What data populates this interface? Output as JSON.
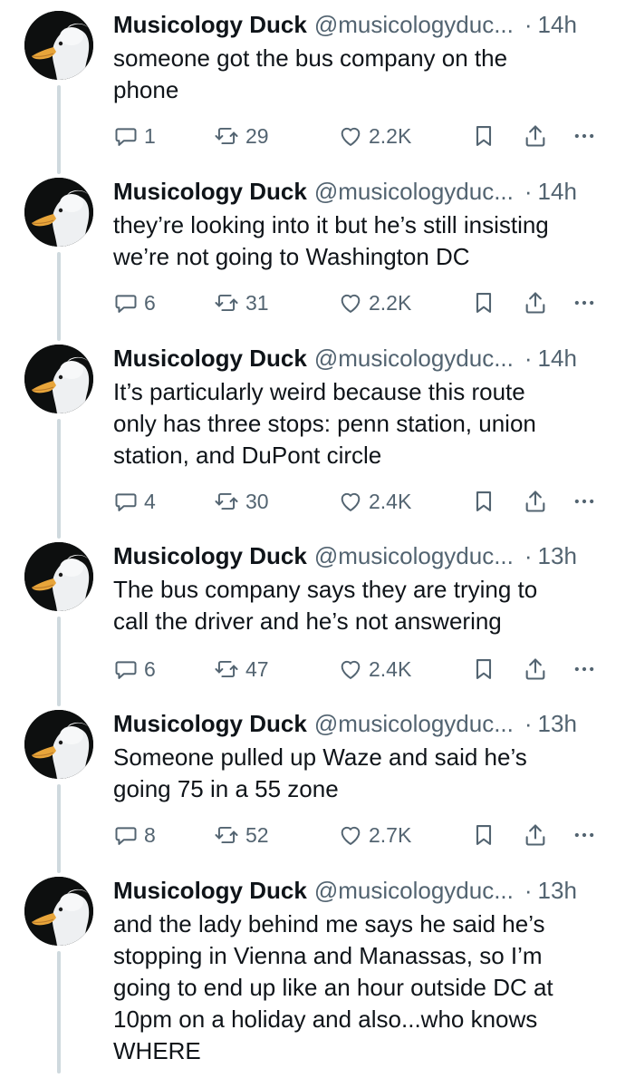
{
  "colors": {
    "text": "#0f1419",
    "secondary": "#536471",
    "thread_line": "#cfd9de",
    "background": "#ffffff"
  },
  "icons": {
    "reply": "reply-icon",
    "retweet": "retweet-icon",
    "like": "heart-icon",
    "bookmark": "bookmark-icon",
    "share": "share-icon",
    "more": "more-icon",
    "avatar": "duck-avatar"
  },
  "tweets": [
    {
      "name": "Musicology Duck",
      "handle": "@musicologyduc...",
      "separator": "·",
      "time": "14h",
      "text": "someone got the bus company on the\nphone",
      "replies": "1",
      "retweets": "29",
      "likes": "2.2K"
    },
    {
      "name": "Musicology Duck",
      "handle": "@musicologyduc...",
      "separator": "·",
      "time": "14h",
      "text": "they’re looking into it but he’s still insisting\nwe’re not going to Washington DC",
      "replies": "6",
      "retweets": "31",
      "likes": "2.2K"
    },
    {
      "name": "Musicology Duck",
      "handle": "@musicologyduc...",
      "separator": "·",
      "time": "14h",
      "text": "It’s particularly weird because this route\nonly has three stops: penn station, union\nstation, and DuPont circle",
      "replies": "4",
      "retweets": "30",
      "likes": "2.4K"
    },
    {
      "name": "Musicology Duck",
      "handle": "@musicologyduc...",
      "separator": "·",
      "time": "13h",
      "text": "The bus company says they are trying to\ncall the driver and he’s not answering",
      "replies": "6",
      "retweets": "47",
      "likes": "2.4K"
    },
    {
      "name": "Musicology Duck",
      "handle": "@musicologyduc...",
      "separator": "·",
      "time": "13h",
      "text": "Someone pulled up Waze and said he’s\ngoing 75 in a 55 zone",
      "replies": "8",
      "retweets": "52",
      "likes": "2.7K"
    },
    {
      "name": "Musicology Duck",
      "handle": "@musicologyduc...",
      "separator": "·",
      "time": "13h",
      "text": "and the lady behind me says he said he’s\nstopping in Vienna and Manassas, so I’m\ngoing to end up like an hour outside DC at\n10pm on a holiday and also...who knows\nWHERE"
    }
  ]
}
